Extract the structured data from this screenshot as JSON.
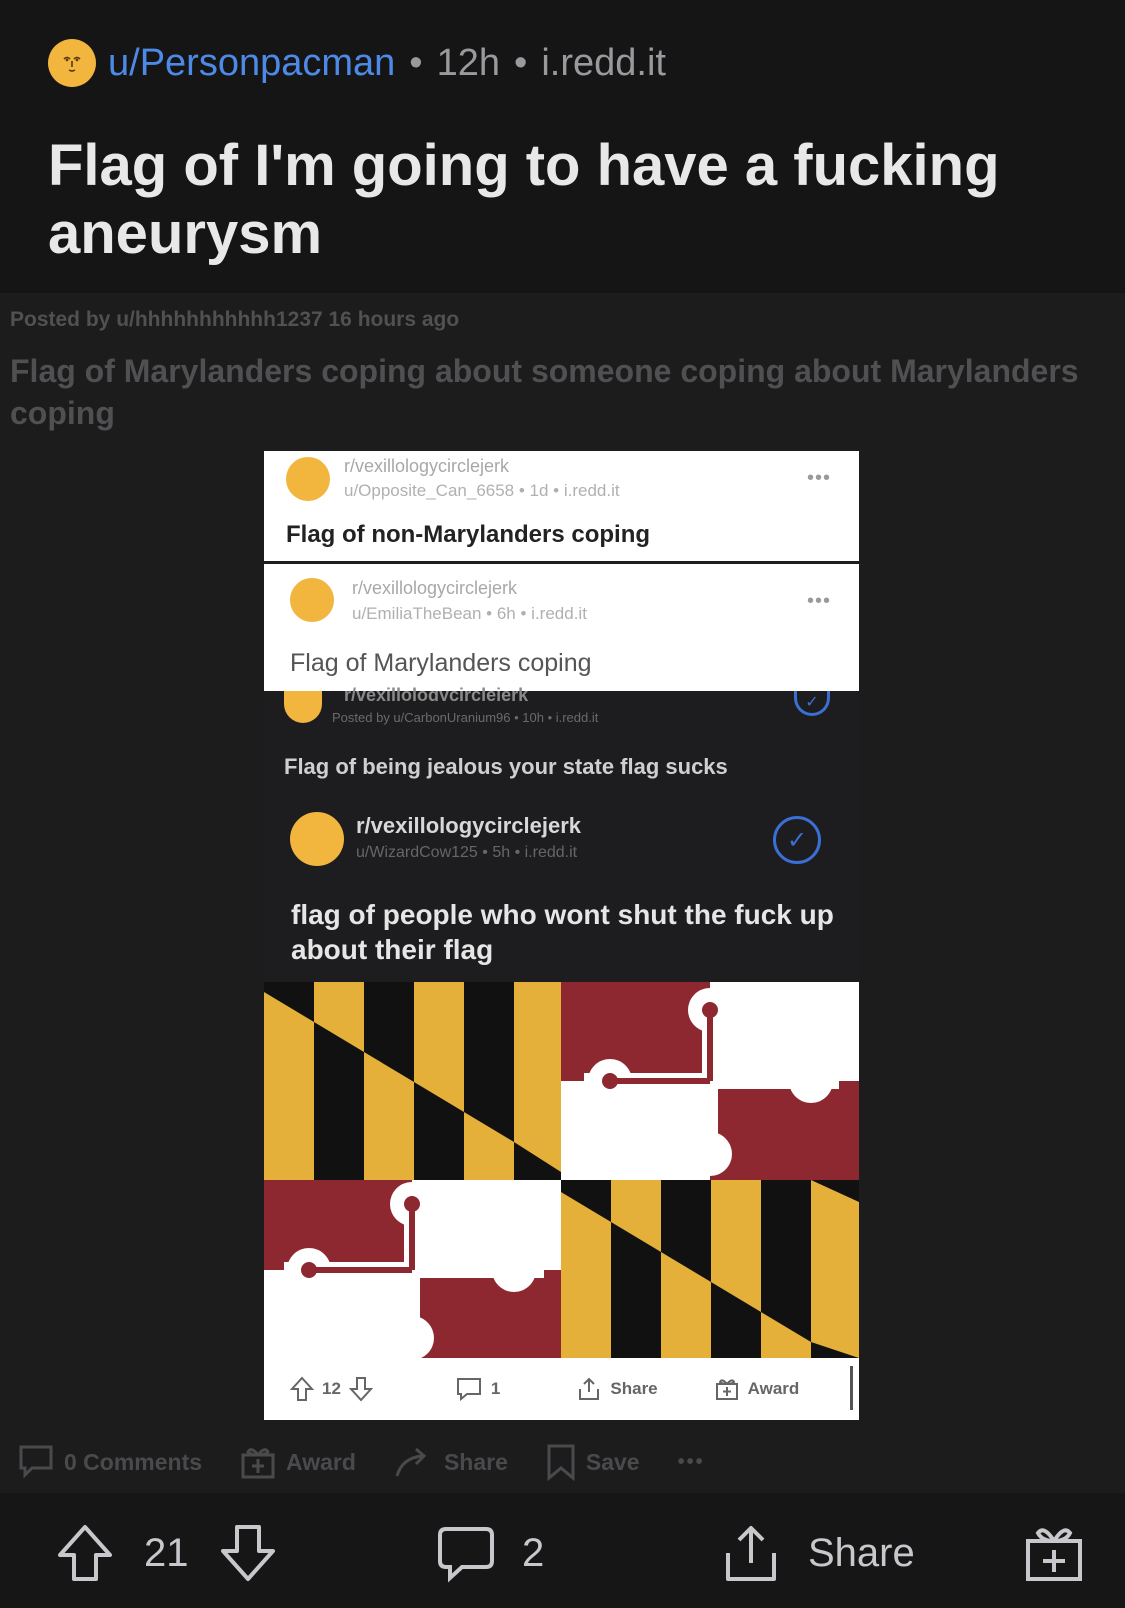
{
  "post": {
    "author": "u/Personpacman",
    "age": "12h",
    "domain": "i.redd.it",
    "title": "Flag of I'm going to have a fucking aneurysm"
  },
  "crosspost": {
    "byline": "Posted by u/hhhhhhhhhhh1237 16 hours ago",
    "title": "Flag of Marylanders coping about someone coping about Marylanders coping"
  },
  "screenshot": {
    "cards": [
      {
        "sub": "r/vexillologycirclejerk",
        "meta": "u/Opposite_Can_6658 • 1d • i.redd.it",
        "title": "Flag of non-Marylanders coping",
        "dots": "•••"
      },
      {
        "sub": "r/vexillologycirclejerk",
        "meta": "u/EmiliaTheBean • 6h • i.redd.it",
        "title": "Flag of Marylanders coping",
        "dots": "•••"
      },
      {
        "sub": "r/vexillologycirclejerk",
        "meta": "Posted by u/CarbonUranium96 • 10h • i.redd.it",
        "title": "Flag of being jealous your state flag sucks"
      },
      {
        "sub": "r/vexillologycirclejerk",
        "meta": "u/WizardCow125 • 5h • i.redd.it",
        "title": "flag of people who wont shut the fuck up about their flag"
      }
    ],
    "actions": {
      "votes": "12",
      "comments": "1",
      "share": "Share",
      "award": "Award"
    }
  },
  "toolbar": {
    "comments": "0 Comments",
    "award": "Award",
    "share": "Share",
    "save": "Save",
    "more": "•••"
  },
  "bottom_bar": {
    "votes": "21",
    "comments": "2",
    "share": "Share"
  },
  "colors": {
    "author": "#4d8ae8",
    "avatar": "#f2b53d",
    "flag_gold": "#e4b03a",
    "flag_red": "#8e2830",
    "check_blue": "#3a6fd3"
  }
}
